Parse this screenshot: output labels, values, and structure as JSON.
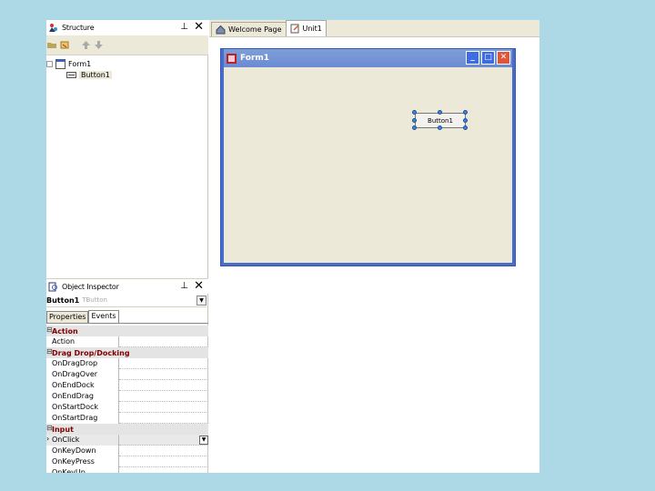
{
  "structure_panel": {
    "title": "Structure",
    "pin_glyph": "⊥",
    "close_glyph": "✕",
    "tree": [
      {
        "label": "Form1",
        "icon": "form-icon"
      },
      {
        "label": "Button1",
        "icon": "button-component-icon"
      }
    ]
  },
  "object_inspector": {
    "title": "Object Inspector",
    "pin_glyph": "⊥",
    "close_glyph": "✕",
    "selected_component": "Button1",
    "selected_type": "TButton",
    "tabs": [
      "Properties",
      "Events"
    ],
    "active_tab": "Events",
    "rows": [
      {
        "kind": "category",
        "label": "Action"
      },
      {
        "kind": "prop",
        "label": "Action"
      },
      {
        "kind": "category",
        "label": "Drag Drop/Docking"
      },
      {
        "kind": "prop",
        "label": "OnDragDrop"
      },
      {
        "kind": "prop",
        "label": "OnDragOver"
      },
      {
        "kind": "prop",
        "label": "OnEndDock"
      },
      {
        "kind": "prop",
        "label": "OnEndDrag"
      },
      {
        "kind": "prop",
        "label": "OnStartDock"
      },
      {
        "kind": "prop",
        "label": "OnStartDrag"
      },
      {
        "kind": "category",
        "label": "Input"
      },
      {
        "kind": "prop",
        "label": "OnClick",
        "selected": true
      },
      {
        "kind": "prop",
        "label": "OnKeyDown"
      },
      {
        "kind": "prop",
        "label": "OnKeyPress"
      },
      {
        "kind": "prop",
        "label": "OnKeyUp"
      }
    ]
  },
  "editor_tabs": [
    {
      "label": "Welcome Page",
      "icon": "house-icon",
      "active": false
    },
    {
      "label": "Unit1",
      "icon": "unit-file-icon",
      "active": true
    }
  ],
  "form_designer": {
    "title": "Form1",
    "button_caption": "Button1",
    "min_glyph": "_",
    "max_glyph": "□",
    "close_glyph": "✕"
  },
  "colors": {
    "background": "#add8e6",
    "category_text": "#800000",
    "form_titlebar": "#6a8ad3",
    "form_client": "#ece9d8"
  }
}
